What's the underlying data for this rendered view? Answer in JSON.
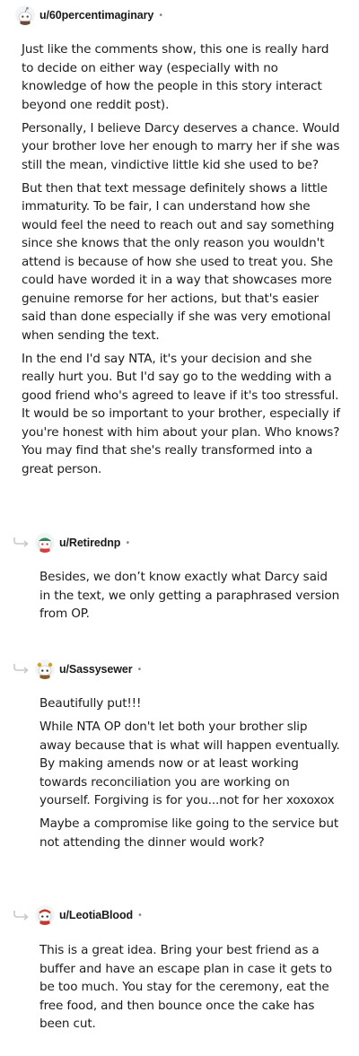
{
  "comments": [
    {
      "username": "u/60percentimaginary",
      "separator": "•",
      "paragraphs": [
        "Just like the comments show, this one is really hard to decide on either way (especially with no knowledge of how the people in this story interact beyond one reddit post).",
        "Personally, I believe Darcy deserves a chance. Would your brother love her enough to marry her if she was still the mean, vindictive little kid she used to be?",
        "But then that text message definitely shows a little immaturity. To be fair, I can understand how she would feel the need to reach out and say something since she knows that the only reason you wouldn't attend is because of how she used to treat you. She could have worded it in a way that showcases more genuine remorse for her actions, but that's easier said than done especially if she was very emotional when sending the text.",
        "In the end I'd say NTA, it's your decision and she really hurt you. But I'd say go to the wedding with a good friend who's agreed to leave if it's too stressful. It would be so important to your brother, especially if you're honest with him about your plan. Who knows? You may find that she's really transformed into a great person."
      ]
    },
    {
      "username": "u/Retirednp",
      "separator": "•",
      "paragraphs": [
        "Besides, we don’t know exactly what Darcy said in the text, we only getting a paraphrased version from OP."
      ]
    },
    {
      "username": "u/Sassysewer",
      "separator": "•",
      "paragraphs": [
        "Beautifully put!!!",
        "While NTA OP don't let both your brother slip away because that is what will happen eventually. By making amends now or at least working towards reconciliation you are working on yourself. Forgiving is for you...not for her xoxoxox",
        "Maybe a compromise like going to the service but not attending the dinner would work?"
      ]
    },
    {
      "username": "u/LeotiaBlood",
      "separator": "•",
      "paragraphs": [
        "This is a great idea. Bring your best friend as a buffer and have an escape plan in case it gets to be too much. You stay for the ceremony, eat the free food, and then bounce once the cake has been cut."
      ]
    }
  ],
  "icons": {
    "avatar": "reddit-snoo-avatar",
    "reply": "reply-arrow-icon"
  },
  "colors": {
    "text": "#1c1c1c",
    "username": "#1a1a1b",
    "meta": "#878a8c",
    "reply_arrow": "#c6c9cc"
  }
}
